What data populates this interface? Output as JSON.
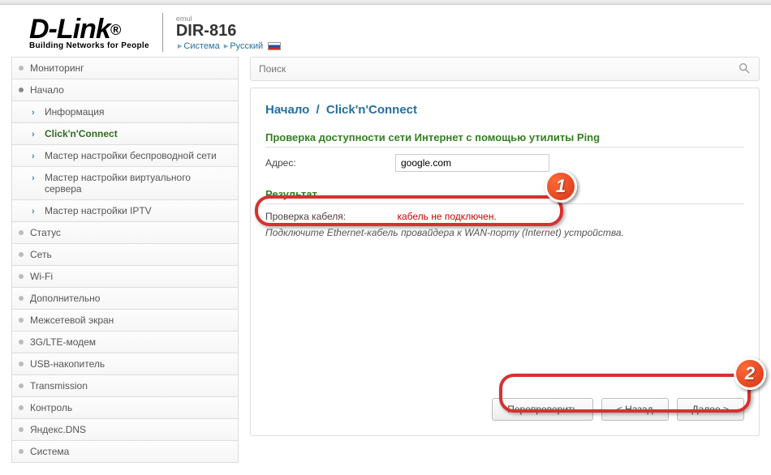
{
  "logo": {
    "main": "D-Link",
    "sup": "®",
    "sub": "Building Networks for People"
  },
  "header": {
    "emul": "emul",
    "model": "DIR-816",
    "nav1": "Система",
    "nav2": "Русский"
  },
  "sidebar": {
    "items": [
      {
        "label": "Мониторинг",
        "type": "top"
      },
      {
        "label": "Начало",
        "type": "top",
        "open": true
      },
      {
        "label": "Информация",
        "type": "child"
      },
      {
        "label": "Click'n'Connect",
        "type": "child",
        "active": true
      },
      {
        "label": "Мастер настройки беспроводной сети",
        "type": "child"
      },
      {
        "label": "Мастер настройки виртуального сервера",
        "type": "child"
      },
      {
        "label": "Мастер настройки IPTV",
        "type": "child"
      },
      {
        "label": "Статус",
        "type": "top"
      },
      {
        "label": "Сеть",
        "type": "top"
      },
      {
        "label": "Wi-Fi",
        "type": "top"
      },
      {
        "label": "Дополнительно",
        "type": "top"
      },
      {
        "label": "Межсетевой экран",
        "type": "top"
      },
      {
        "label": "3G/LTE-модем",
        "type": "top"
      },
      {
        "label": "USB-накопитель",
        "type": "top"
      },
      {
        "label": "Transmission",
        "type": "top"
      },
      {
        "label": "Контроль",
        "type": "top"
      },
      {
        "label": "Яндекс.DNS",
        "type": "top"
      },
      {
        "label": "Система",
        "type": "top"
      }
    ]
  },
  "search": {
    "placeholder": "Поиск"
  },
  "breadcrumb": {
    "root": "Начало",
    "page": "Click'n'Connect"
  },
  "ping": {
    "title_full": "Проверка доступности сети Интернет с помощью утилиты Ping",
    "addr_label": "Адрес:",
    "addr_value": "google.com"
  },
  "result": {
    "title": "Результат",
    "cable_label": "Проверка кабеля:",
    "cable_value": "кабель не подключен.",
    "hint": "Подключите Ethernet-кабель провайдера к WAN-порту (Internet) устройства."
  },
  "buttons": {
    "recheck": "Перепроверить",
    "back": "< Назад",
    "next": "Далее >"
  },
  "badges": {
    "b1": "1",
    "b2": "2"
  }
}
